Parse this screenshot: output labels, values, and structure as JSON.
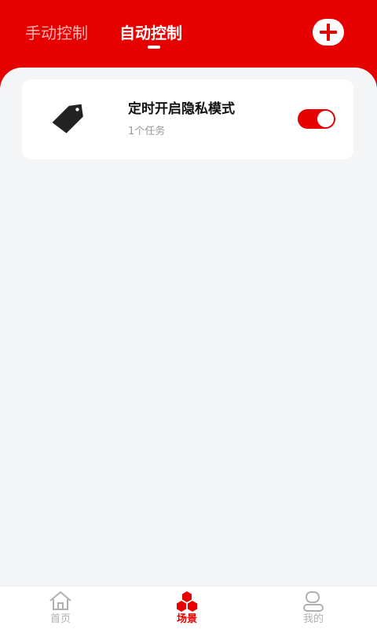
{
  "header": {
    "tabs": [
      {
        "label": "手动控制",
        "active": false
      },
      {
        "label": "自动控制",
        "active": true
      }
    ],
    "add_icon": "plus-icon"
  },
  "scene_list": [
    {
      "icon": "tag-icon",
      "title": "定时开启隐私模式",
      "subtitle": "1个任务",
      "enabled": true
    }
  ],
  "bottom_nav": {
    "items": [
      {
        "label": "首页",
        "icon": "home-icon",
        "active": false
      },
      {
        "label": "场景",
        "icon": "scene-hexagon-icon",
        "active": true
      },
      {
        "label": "我的",
        "icon": "profile-icon",
        "active": false
      }
    ]
  },
  "colors": {
    "brand": "#e60000",
    "background": "#f4f5f7",
    "inactive_nav": "#b0b0b0"
  }
}
